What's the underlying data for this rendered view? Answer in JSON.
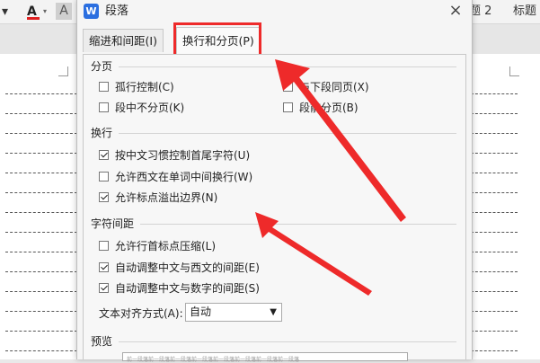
{
  "background_doc": {
    "font_color_letter": "A",
    "char_shading_letter": "A",
    "style_heading2": "题 2",
    "style_heading": "标题"
  },
  "dialog": {
    "title": "段落",
    "app_icon_letter": "W",
    "close_symbol": "×",
    "tabs": [
      {
        "label": "缩进和间距(I)",
        "active": false
      },
      {
        "label": "换行和分页(P)",
        "active": true
      }
    ],
    "highlight_color": "#ee2a2a",
    "sections": {
      "pagination": {
        "title": "分页",
        "options": [
          {
            "label": "孤行控制(C)",
            "checked": false
          },
          {
            "label": "与下段同页(X)",
            "checked": false
          },
          {
            "label": "段中不分页(K)",
            "checked": false
          },
          {
            "label": "段前分页(B)",
            "checked": false
          }
        ]
      },
      "line_break": {
        "title": "换行",
        "options": [
          {
            "label": "按中文习惯控制首尾字符(U)",
            "checked": true
          },
          {
            "label": "允许西文在单词中间换行(W)",
            "checked": false
          },
          {
            "label": "允许标点溢出边界(N)",
            "checked": true
          }
        ]
      },
      "char_spacing": {
        "title": "字符间距",
        "options": [
          {
            "label": "允许行首标点压缩(L)",
            "checked": false
          },
          {
            "label": "自动调整中文与西文的间距(E)",
            "checked": true
          },
          {
            "label": "自动调整中文与数字的间距(S)",
            "checked": true
          }
        ],
        "text_align_label": "文本对齐方式(A):",
        "text_align_value": "自动"
      },
      "preview": {
        "title": "预览",
        "sample": "前一段落前一段落前一段落前一段落前一段落前一段落前一段落前一段落"
      }
    }
  }
}
